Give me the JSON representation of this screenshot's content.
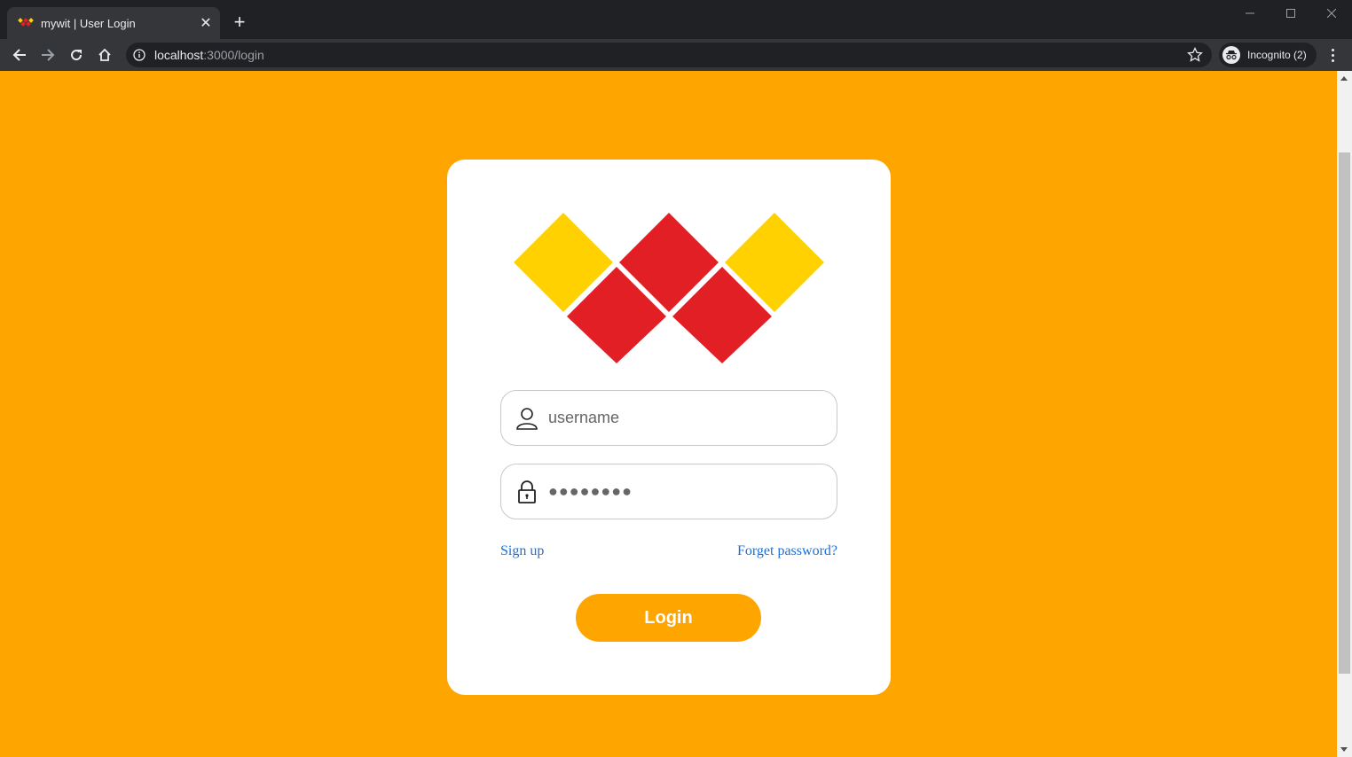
{
  "browser": {
    "tab_title": "mywit | User Login",
    "url_host": "localhost",
    "url_path": ":3000/login",
    "profile_label": "Incognito (2)"
  },
  "login": {
    "username_placeholder": "username",
    "password_value": "●●●●●●●●",
    "signup_label": "Sign up",
    "forgot_label": "Forget password?",
    "login_label": "Login"
  },
  "colors": {
    "background": "#ffa500",
    "logo_red": "#e31f26",
    "logo_yellow": "#ffd100",
    "link": "#1a6fd9"
  },
  "icons": {
    "username": "user-icon",
    "password": "lock-icon"
  }
}
